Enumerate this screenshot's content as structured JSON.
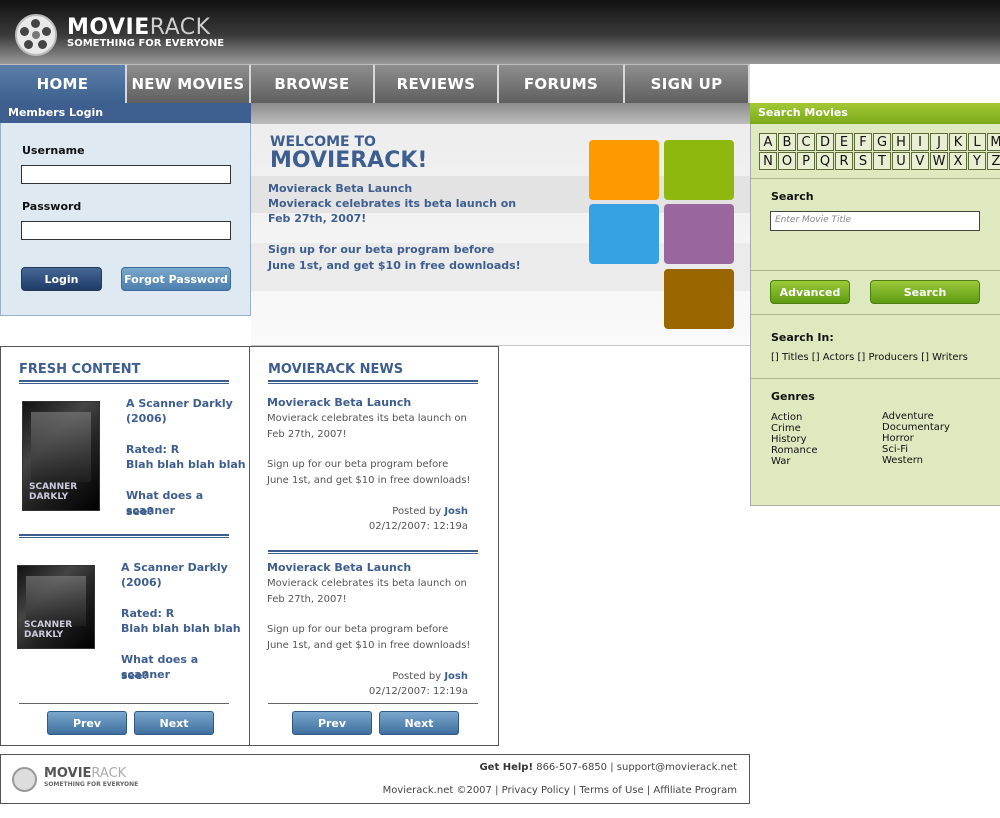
{
  "brand": {
    "name_bold": "MOVIE",
    "name_light": "RACK",
    "tagline": "SOMETHING FOR EVERYONE"
  },
  "nav": [
    {
      "label": "HOME",
      "active": true
    },
    {
      "label": "NEW MOVIES"
    },
    {
      "label": "BROWSE"
    },
    {
      "label": "REVIEWS"
    },
    {
      "label": "FORUMS"
    },
    {
      "label": "SIGN UP"
    }
  ],
  "login": {
    "title": "Members Login",
    "username_label": "Username",
    "password_label": "Password",
    "username_value": "",
    "password_value": "",
    "login_button": "Login",
    "forgot_button": "Forgot Password"
  },
  "welcome": {
    "to": "WELCOME TO",
    "title": "MOVIERACK!",
    "line1": "Movierack Beta Launch",
    "line2": "Movierack celebrates its beta launch on",
    "line3": "Feb 27th, 2007!",
    "line4": "Sign up for our beta program before",
    "line5": "June 1st, and get $10 in free downloads!",
    "colors": [
      "#ff9900",
      "#8fb80f",
      "#36a2e3",
      "#99669e",
      "#996600"
    ]
  },
  "search": {
    "title": "Search Movies",
    "letters_row1": [
      "A",
      "B",
      "C",
      "D",
      "E",
      "F",
      "G",
      "H",
      "I",
      "J",
      "K",
      "L",
      "M"
    ],
    "letters_row2": [
      "N",
      "O",
      "P",
      "Q",
      "R",
      "S",
      "T",
      "U",
      "V",
      "W",
      "X",
      "Y",
      "Z"
    ],
    "search_label": "Search",
    "placeholder": "Enter Movie Title",
    "advanced_button": "Advanced",
    "search_button": "Search",
    "search_in_label": "Search In:",
    "search_in_options": "[] Titles [] Actors [] Producers [] Writers",
    "genres_label": "Genres",
    "genres_left": [
      "Action",
      "Crime",
      "History",
      "Romance",
      "War"
    ],
    "genres_right": [
      "Adventure",
      "Documentary",
      "Horror",
      "Sci-Fi",
      "Western"
    ]
  },
  "fresh": {
    "title": "FRESH CONTENT",
    "items": [
      {
        "title": "A Scanner Darkly",
        "year": "(2006)",
        "rated": "Rated: R",
        "blurb": "Blah blah blah blah",
        "question": "What does a scanner",
        "question2": "see?",
        "cover_text": "SCANNER DARKLY"
      },
      {
        "title": "A Scanner Darkly",
        "year": "(2006)",
        "rated": "Rated: R",
        "blurb": "Blah blah blah blah",
        "question": "What does a scanner",
        "question2": "see?",
        "cover_text": "SCANNER DARKLY"
      }
    ],
    "prev": "Prev",
    "next": "Next"
  },
  "news": {
    "title": "MOVIERACK NEWS",
    "items": [
      {
        "headline": "Movierack Beta Launch",
        "body1": "Movierack celebrates its beta launch on",
        "body2": "Feb 27th, 2007!",
        "body3": "Sign up for our beta program before",
        "body4": "June 1st, and get $10 in free downloads!",
        "posted_by": "Posted by",
        "author": "Josh",
        "date": "02/12/2007: 12:19a"
      },
      {
        "headline": "Movierack Beta Launch",
        "body1": "Movierack celebrates its beta launch on",
        "body2": "Feb 27th, 2007!",
        "body3": "Sign up for our beta program before",
        "body4": "June 1st, and get $10 in free downloads!",
        "posted_by": "Posted by",
        "author": "Josh",
        "date": "02/12/2007: 12:19a"
      }
    ],
    "prev": "Prev",
    "next": "Next"
  },
  "footer": {
    "help_label": "Get Help!",
    "help_text": "866-507-6850 | support@movierack.net",
    "links": "Movierack.net ©2007 | Privacy Policy | Terms of Use | Affiliate Program"
  }
}
